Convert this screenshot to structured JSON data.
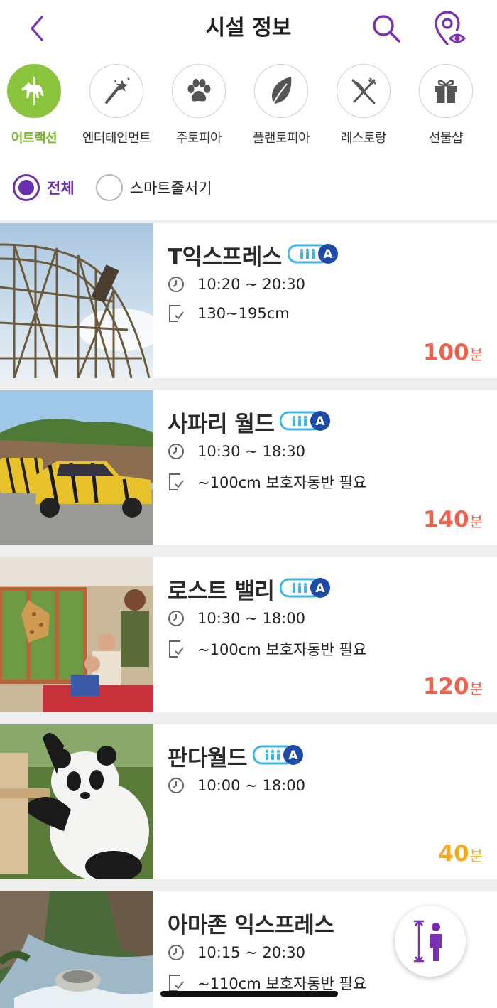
{
  "header": {
    "title": "시설 정보",
    "back_icon": "chevron-left-icon",
    "search_icon": "search-icon",
    "map_icon": "map-pin-eye-icon",
    "accent_color": "#7a2fb5"
  },
  "categories": [
    {
      "label": "어트랙션",
      "icon": "carousel-horse-icon",
      "active": true
    },
    {
      "label": "엔터테인먼트",
      "icon": "magic-wand-icon",
      "active": false
    },
    {
      "label": "주토피아",
      "icon": "paw-icon",
      "active": false
    },
    {
      "label": "플랜토피아",
      "icon": "leaf-icon",
      "active": false
    },
    {
      "label": "레스토랑",
      "icon": "fork-knife-icon",
      "active": false
    },
    {
      "label": "선물샵",
      "icon": "gift-icon",
      "active": false
    }
  ],
  "category_active_color": "#8ac33c",
  "filters": [
    {
      "label": "전체",
      "checked": true
    },
    {
      "label": "스마트줄서기",
      "checked": false
    }
  ],
  "attractions": [
    {
      "name": "T익스프레스",
      "badge": true,
      "badge_letter": "A",
      "hours": "10:20 ~ 20:30",
      "requirement": "130~195cm",
      "wait": "100",
      "wait_unit": "분",
      "wait_color": "#f0604a",
      "image": "wooden-roller-coaster"
    },
    {
      "name": "사파리 월드",
      "badge": true,
      "badge_letter": "A",
      "hours": "10:30 ~ 18:30",
      "requirement": "~100cm 보호자동반 필요",
      "wait": "140",
      "wait_unit": "분",
      "wait_color": "#f0604a",
      "image": "safari-tiger-truck"
    },
    {
      "name": "로스트 밸리",
      "badge": true,
      "badge_letter": "A",
      "hours": "10:30 ~ 18:00",
      "requirement": "~100cm 보호자동반 필요",
      "wait": "120",
      "wait_unit": "분",
      "wait_color": "#f0604a",
      "image": "giraffe-bus-family"
    },
    {
      "name": "판다월드",
      "badge": true,
      "badge_letter": "A",
      "hours": "10:00 ~ 18:00",
      "requirement": "",
      "wait": "40",
      "wait_unit": "분",
      "wait_color": "#f5a91c",
      "image": "panda"
    },
    {
      "name": "아마존 익스프레스",
      "badge": false,
      "badge_letter": "",
      "hours": "10:15 ~ 20:30",
      "requirement": "~110cm 보호자동반 필요",
      "wait": "",
      "wait_unit": "",
      "wait_color": "#f0604a",
      "image": "river-rafting"
    }
  ],
  "fab": {
    "icon": "height-measure-person-icon"
  }
}
